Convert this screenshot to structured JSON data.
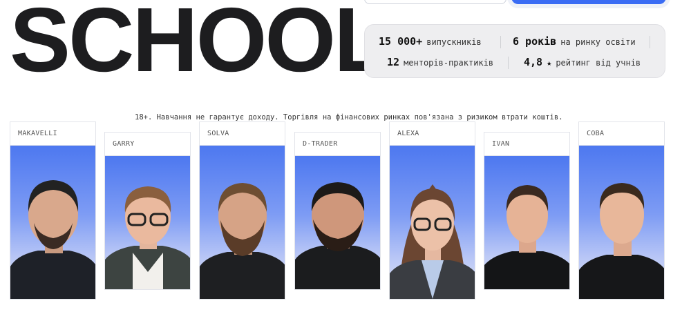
{
  "brand": {
    "title": "SCHOOL"
  },
  "stats": {
    "graduates_num": "15 000+",
    "graduates_label": "випускників",
    "years_num": "6 років",
    "years_label": "на ринку освіти",
    "mentors_num": "12",
    "mentors_label": "менторів-практиків",
    "rating_num": "4,8",
    "rating_star": "★",
    "rating_label": "рейтинг від учнів"
  },
  "disclaimer": "18+. Навчання не гарантує доходу. Торгівля на фінансових ринках пов'язана з ризиком втрати коштів.",
  "mentors": [
    {
      "name": "MAKAVELLI"
    },
    {
      "name": "GARRY"
    },
    {
      "name": "SOLVA"
    },
    {
      "name": "D-TRADER"
    },
    {
      "name": "ALEXA"
    },
    {
      "name": "IVAN"
    },
    {
      "name": "COBA"
    }
  ],
  "colors": {
    "accent": "#3a6cf4",
    "photo_bg_top": "#4d78f0",
    "panel_bg": "#eeeef0"
  }
}
